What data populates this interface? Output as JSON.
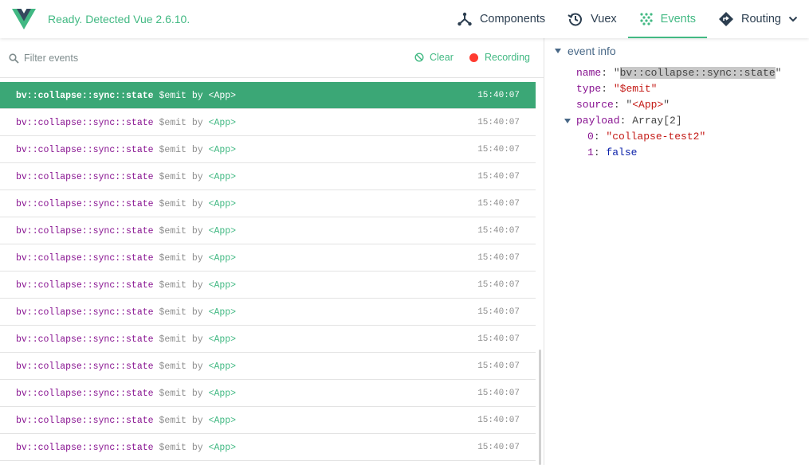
{
  "header": {
    "status": "Ready. Detected Vue 2.6.10.",
    "tabs": [
      {
        "label": "Components",
        "icon": "components-icon"
      },
      {
        "label": "Vuex",
        "icon": "history-icon"
      },
      {
        "label": "Events",
        "icon": "events-icon",
        "active": true
      },
      {
        "label": "Routing",
        "icon": "routing-icon"
      }
    ],
    "accent": "#42b983"
  },
  "events": {
    "filter_placeholder": "Filter events",
    "clear_label": "Clear",
    "recording_label": "Recording",
    "rows": [
      {
        "name": "bv::collapse::sync::state",
        "type": "$emit",
        "by": "by",
        "source": "<App>",
        "time": "15:40:07"
      },
      {
        "name": "bv::collapse::sync::state",
        "type": "$emit",
        "by": "by",
        "source": "<App>",
        "time": "15:40:07"
      },
      {
        "name": "bv::collapse::sync::state",
        "type": "$emit",
        "by": "by",
        "source": "<App>",
        "time": "15:40:07"
      },
      {
        "name": "bv::collapse::sync::state",
        "type": "$emit",
        "by": "by",
        "source": "<App>",
        "time": "15:40:07"
      },
      {
        "name": "bv::collapse::sync::state",
        "type": "$emit",
        "by": "by",
        "source": "<App>",
        "time": "15:40:07"
      },
      {
        "name": "bv::collapse::sync::state",
        "type": "$emit",
        "by": "by",
        "source": "<App>",
        "time": "15:40:07"
      },
      {
        "name": "bv::collapse::sync::state",
        "type": "$emit",
        "by": "by",
        "source": "<App>",
        "time": "15:40:07"
      },
      {
        "name": "bv::collapse::sync::state",
        "type": "$emit",
        "by": "by",
        "source": "<App>",
        "time": "15:40:07"
      },
      {
        "name": "bv::collapse::sync::state",
        "type": "$emit",
        "by": "by",
        "source": "<App>",
        "time": "15:40:07"
      },
      {
        "name": "bv::collapse::sync::state",
        "type": "$emit",
        "by": "by",
        "source": "<App>",
        "time": "15:40:07"
      },
      {
        "name": "bv::collapse::sync::state",
        "type": "$emit",
        "by": "by",
        "source": "<App>",
        "time": "15:40:07"
      },
      {
        "name": "bv::collapse::sync::state",
        "type": "$emit",
        "by": "by",
        "source": "<App>",
        "time": "15:40:07"
      },
      {
        "name": "bv::collapse::sync::state",
        "type": "$emit",
        "by": "by",
        "source": "<App>",
        "time": "15:40:07"
      },
      {
        "name": "bv::collapse::sync::state",
        "type": "$emit",
        "by": "by",
        "source": "<App>",
        "time": "15:40:07"
      }
    ]
  },
  "info": {
    "title": "event info",
    "name_key": "name",
    "name_value": "bv::collapse::sync::state",
    "type_key": "type",
    "type_value": "$emit",
    "source_key": "source",
    "source_value": "<App>",
    "payload_key": "payload",
    "payload_type": "Array[2]",
    "items": [
      {
        "index": "0",
        "value": "\"collapse-test2\""
      },
      {
        "index": "1",
        "value": "false"
      }
    ]
  }
}
